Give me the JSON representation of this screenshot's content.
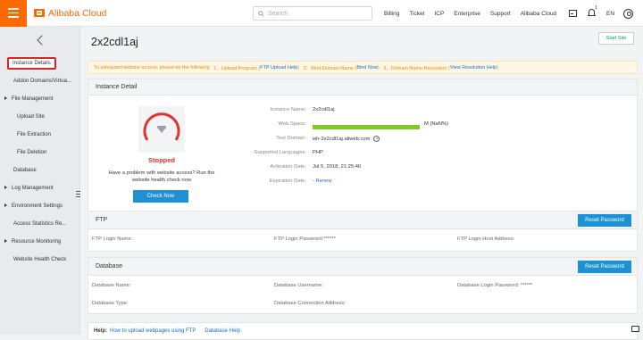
{
  "brand": {
    "name": "Alibaba Cloud",
    "accent": "#ff6a00"
  },
  "search": {
    "placeholder": "Search"
  },
  "nav": [
    "Billing",
    "Ticket",
    "ICP",
    "Enterprise",
    "Support",
    "Alibaba Cloud"
  ],
  "header": {
    "notifications": "1",
    "language": "EN"
  },
  "sidebar": {
    "items": [
      {
        "label": "Instance Details",
        "active": true
      },
      {
        "label": "Addon Domains/Virtua..."
      },
      {
        "label": "File Management",
        "expandable": true
      },
      {
        "label": "Upload Site"
      },
      {
        "label": "File Extraction"
      },
      {
        "label": "File Deletion"
      },
      {
        "label": "Database"
      },
      {
        "label": "Log Management",
        "expandable": true
      },
      {
        "label": "Environment Settings",
        "expandable": true
      },
      {
        "label": "Access Statistics Re..."
      },
      {
        "label": "Resource Monitoring",
        "expandable": true
      },
      {
        "label": "Website Health Check"
      }
    ]
  },
  "page": {
    "title": "2x2cdl1aj",
    "start_button": "Start Site"
  },
  "notice": {
    "text": "To safeguard website access, please do the following",
    "step1_prefix": "1、Upload Program (",
    "step1_link": "FTP Upload Help",
    "step2_prefix": "2、Bind Domain Name (",
    "step2_link": "Bind Now",
    "step3_prefix": "3、Domain Name Resolution (",
    "step3_link": "View Resolution Help",
    "close": ")"
  },
  "instance": {
    "heading": "Instance Detail",
    "status": "Stopped",
    "message_line1": "Have a problem with website access? Run the",
    "message_line2": "website health check now",
    "check_button": "Check Now",
    "fields": {
      "name_label": "Instance Name:",
      "name_value": "2x2cdl1aj",
      "space_label": "Web Space:",
      "space_value": "M (NaN%)",
      "domain_label": "Test Domain:",
      "domain_value": "wh-2x2cdl1aj.aliweb.com",
      "lang_label": "Supported Languages:",
      "lang_value": "PHP",
      "activation_label": "Activation Date:",
      "activation_value": "Jul 5, 2018, 21:25:40",
      "expiration_label": "Expiration Date:",
      "expiration_value": "- Renew"
    }
  },
  "ftp": {
    "heading": "FTP",
    "reset_button": "Reset Password",
    "login_name": "FTP Login Name:",
    "login_password": "FTP Login Password:******",
    "login_host": "FTP Login Host Address:"
  },
  "database": {
    "heading": "Database",
    "reset_button": "Reset Password",
    "db_name": "Database Name:",
    "db_username": "Database Username:",
    "db_password": "Database Login Password: ******",
    "db_type": "Database Type:",
    "db_address": "Database Connection Address:"
  },
  "help": {
    "label": "Help:",
    "link1": "How to upload webpages using FTP",
    "link2": "Database Help"
  }
}
